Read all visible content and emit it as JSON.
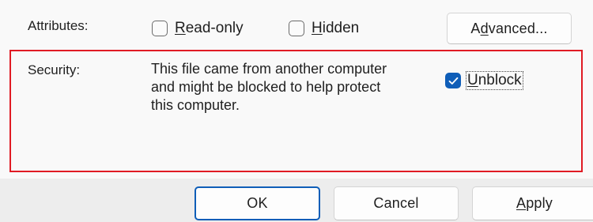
{
  "attributes": {
    "label": "Attributes:",
    "readonly": {
      "label_accel": "R",
      "label_rest": "ead-only",
      "checked": false
    },
    "hidden": {
      "label_accel": "H",
      "label_rest": "idden",
      "checked": false
    },
    "advanced": {
      "label_pre": "A",
      "label_accel": "d",
      "label_rest": "vanced..."
    }
  },
  "security": {
    "label": "Security:",
    "message_line1": "This file came from another computer",
    "message_line2": "and might be blocked to help protect",
    "message_line3": "this computer.",
    "unblock": {
      "label_accel": "U",
      "label_rest": "nblock",
      "checked": true
    },
    "highlight_color": "#e01b24"
  },
  "footer": {
    "ok_label": "OK",
    "cancel_label": "Cancel",
    "apply": {
      "label_accel": "A",
      "label_rest": "pply"
    }
  },
  "colors": {
    "accent": "#0f5eb8",
    "background": "#f9f9f9",
    "footer_background": "#ededed"
  },
  "icons": {
    "checkmark": "checkmark-icon"
  }
}
